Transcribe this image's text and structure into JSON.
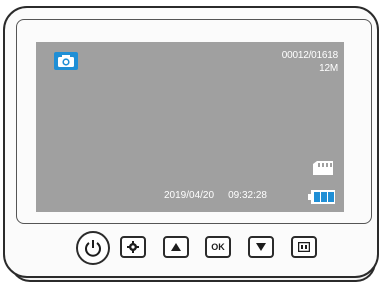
{
  "screen": {
    "mode_icon": "camera-icon",
    "counter": "00012/01618",
    "resolution": "12M",
    "date": "2019/04/20",
    "time": "09:32:28",
    "storage_icon": "sd-card-icon",
    "battery_icon": "battery-icon",
    "battery_level": 0.75
  },
  "buttons": {
    "power_icon": "power-icon",
    "settings_icon": "settings-icon",
    "up_icon": "up-arrow-icon",
    "ok_label": "OK",
    "down_icon": "down-arrow-icon",
    "menu_icon": "menu-icon"
  },
  "colors": {
    "screen_bg": "#a0a0a0",
    "camera_badge": "#1f8fd6",
    "frame": "#2b2b2b",
    "text": "#ffffff"
  }
}
